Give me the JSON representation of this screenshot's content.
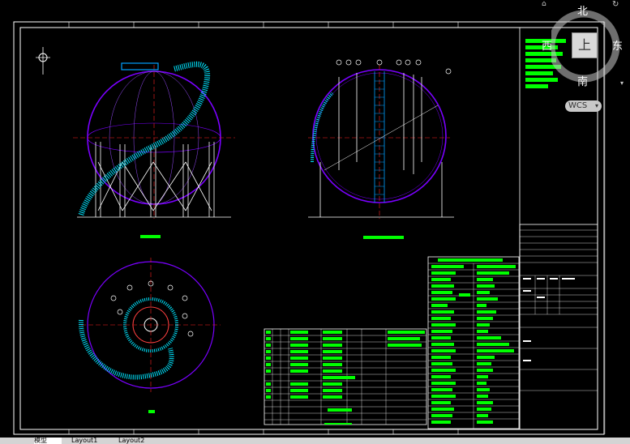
{
  "viewcube": {
    "north": "北",
    "south": "南",
    "east": "东",
    "west": "西",
    "top": "上",
    "wcs": "WCS"
  },
  "tabs": [
    {
      "label": "模型"
    },
    {
      "label": "Layout1"
    },
    {
      "label": "Layout2"
    }
  ],
  "drawing": {
    "tank1_label": "",
    "table_title_1": "DESIGN & TEST CONDITION",
    "table_title_2": "PROCESS NOZZLES",
    "table_title_3": "INSTRUMENT NOZZLES",
    "table_title_4": "NOZZLE SCHEDULE"
  },
  "colors": {
    "background": "#000000",
    "frame": "#ffffff",
    "text_highlight": "#00ff00",
    "sphere": "#7a00ff",
    "ladder": "#00e5ff",
    "center_line": "#ff2020"
  }
}
